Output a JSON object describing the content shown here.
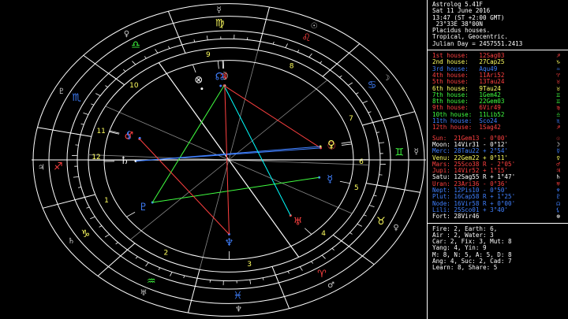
{
  "header": {
    "app": "Astrolog 5.41F",
    "date": "Sat 11 June 2016",
    "time": "13:47 (ST +2:00 GMT)",
    "location": " 23°33E 38°00N",
    "houses": "Placidus houses.",
    "zodiac": "Tropical, Geocentric.",
    "julian": "Julian Day = 2457551.2413"
  },
  "cusps": [
    {
      "label": "1st house:",
      "value": "12Sag03",
      "sym": "♐",
      "color": "#ff4040"
    },
    {
      "label": "2nd house:",
      "value": "27Cap25",
      "sym": "♑",
      "color": "#ffff60"
    },
    {
      "label": "3rd house:",
      "value": "Aqu49",
      "sym": "♒",
      "color": "#4080ff"
    },
    {
      "label": "4th house:",
      "value": "11Ari52",
      "sym": "♈",
      "color": "#ff4040"
    },
    {
      "label": "5th house:",
      "value": "13Tau24",
      "sym": "♉",
      "color": "#ff4040"
    },
    {
      "label": "6th house:",
      "value": "9Tau24",
      "sym": "♉",
      "color": "#ffff60"
    },
    {
      "label": "7th house:",
      "value": "1Gem42",
      "sym": "♊",
      "color": "#40ff40"
    },
    {
      "label": "8th house:",
      "value": "22Gem03",
      "sym": "♊",
      "color": "#40ff40"
    },
    {
      "label": "9th house:",
      "value": "6Vir49",
      "sym": "♍",
      "color": "#ff4040"
    },
    {
      "label": "10th house:",
      "value": "11Lib52",
      "sym": "♎",
      "color": "#40ff40"
    },
    {
      "label": "11th house:",
      "value": "Sco24",
      "sym": "♏",
      "color": "#4080ff"
    },
    {
      "label": "12th house:",
      "value": "1Sag42",
      "sym": "♐",
      "color": "#ff4040"
    }
  ],
  "planets": [
    {
      "name": "Sun:",
      "pos": "21Gem13",
      "mot": "- 0°00'",
      "sym": "☉",
      "color": "#ff4040"
    },
    {
      "name": "Moon:",
      "pos": "14Vir31",
      "mot": "- 0°12'",
      "sym": "☽",
      "color": "#ffffff"
    },
    {
      "name": "Merc:",
      "pos": "28Tau22",
      "mot": "+ 2°54'",
      "sym": "☿",
      "color": "#4080ff"
    },
    {
      "name": "Venu:",
      "pos": "22Gem22",
      "mot": "+ 0°11'",
      "sym": "♀",
      "color": "#ffff60"
    },
    {
      "name": "Mars:",
      "pos": "25Sco38",
      "mot": "R - 2°05'",
      "sym": "♂",
      "color": "#ff4040"
    },
    {
      "name": "Jupi:",
      "pos": "14Vir52",
      "mot": "+ 1°15'",
      "sym": "♃",
      "color": "#ff4040"
    },
    {
      "name": "Satu:",
      "pos": "12Sag55",
      "mot": "R + 1°47'",
      "sym": "♄",
      "color": "#ffffff"
    },
    {
      "name": "Uran:",
      "pos": "23Ari36",
      "mot": "- 0°36'",
      "sym": "♅",
      "color": "#ff4040"
    },
    {
      "name": "Nept:",
      "pos": "12Pis10",
      "mot": "- 0°50'",
      "sym": "♆",
      "color": "#4080ff"
    },
    {
      "name": "Plut:",
      "pos": "16Cap58",
      "mot": "R + 1°25'",
      "sym": "♇",
      "color": "#4080ff"
    },
    {
      "name": "Node:",
      "pos": "16Vir58",
      "mot": "R + 0°00'",
      "sym": "☊",
      "color": "#4080ff"
    },
    {
      "name": "Lili:",
      "pos": "25Sco01",
      "mot": "+ 3°40'",
      "sym": "⚸",
      "color": "#4080ff"
    },
    {
      "name": "Fort:",
      "pos": "28Vir46",
      "mot": "",
      "sym": "⊗",
      "color": "#ffffff"
    }
  ],
  "stats": [
    "Fire: 2, Earth: 6,",
    "Air : 2, Water: 3",
    "Car: 2, Fix: 3, Mut: 8",
    "Yang: 4, Yin: 9",
    "M: 8, N: 5, A: 5, D: 8",
    "Ang: 4, Suc: 2, Cad: 7",
    "Learn: 8, Share: 5"
  ],
  "wheel": {
    "house_numbers": [
      "1",
      "2",
      "3",
      "4",
      "5",
      "6",
      "7",
      "8",
      "9",
      "10",
      "11",
      "12"
    ],
    "signs": [
      {
        "sym": "♈",
        "color": "#ff4040"
      },
      {
        "sym": "♉",
        "color": "#ffff60"
      },
      {
        "sym": "♊",
        "color": "#40ff40"
      },
      {
        "sym": "♋",
        "color": "#4080ff"
      },
      {
        "sym": "♌",
        "color": "#ff4040"
      },
      {
        "sym": "♍",
        "color": "#ffff60"
      },
      {
        "sym": "♎",
        "color": "#40ff40"
      },
      {
        "sym": "♏",
        "color": "#4080ff"
      },
      {
        "sym": "♐",
        "color": "#ff4040"
      },
      {
        "sym": "♑",
        "color": "#ffff60"
      },
      {
        "sym": "♒",
        "color": "#40ff40"
      },
      {
        "sym": "♓",
        "color": "#4080ff"
      }
    ],
    "rulers": [
      "♂",
      "♀",
      "☿",
      "☽",
      "☉",
      "☿",
      "♀",
      "♇",
      "♃",
      "♄",
      "♅",
      "♆"
    ],
    "planet_glyphs": [
      {
        "sym": "☉",
        "lon": 81.2,
        "color": "#ff4040"
      },
      {
        "sym": "☽",
        "lon": 164.5,
        "color": "#ffffff"
      },
      {
        "sym": "☿",
        "lon": 58.4,
        "color": "#4080ff"
      },
      {
        "sym": "♀",
        "lon": 82.4,
        "color": "#ffff60"
      },
      {
        "sym": "♂",
        "lon": 235.6,
        "color": "#ff4040"
      },
      {
        "sym": "♃",
        "lon": 164.9,
        "color": "#ff4040"
      },
      {
        "sym": "♄",
        "lon": 252.9,
        "color": "#ffffff"
      },
      {
        "sym": "♅",
        "lon": 23.6,
        "color": "#ff4040"
      },
      {
        "sym": "♆",
        "lon": 342.2,
        "color": "#4080ff"
      },
      {
        "sym": "♇",
        "lon": 286.9,
        "color": "#4080ff"
      },
      {
        "sym": "☊",
        "lon": 167.0,
        "color": "#4080ff"
      },
      {
        "sym": "⚸",
        "lon": 235.0,
        "color": "#4080ff"
      },
      {
        "sym": "⊗",
        "lon": 178.8,
        "color": "#ffffff"
      }
    ],
    "aspects": [
      {
        "a": 0,
        "b": 5,
        "color": "#ff4040"
      },
      {
        "a": 0,
        "b": 6,
        "color": "#4080ff"
      },
      {
        "a": 5,
        "b": 9,
        "color": "#40ff40"
      },
      {
        "a": 2,
        "b": 9,
        "color": "#40ff40"
      },
      {
        "a": 3,
        "b": 6,
        "color": "#4080ff"
      },
      {
        "a": 4,
        "b": 8,
        "color": "#ff4040"
      },
      {
        "a": 7,
        "b": 5,
        "color": "#00ffff"
      },
      {
        "a": 1,
        "b": 8,
        "color": "#ff4040"
      }
    ]
  }
}
